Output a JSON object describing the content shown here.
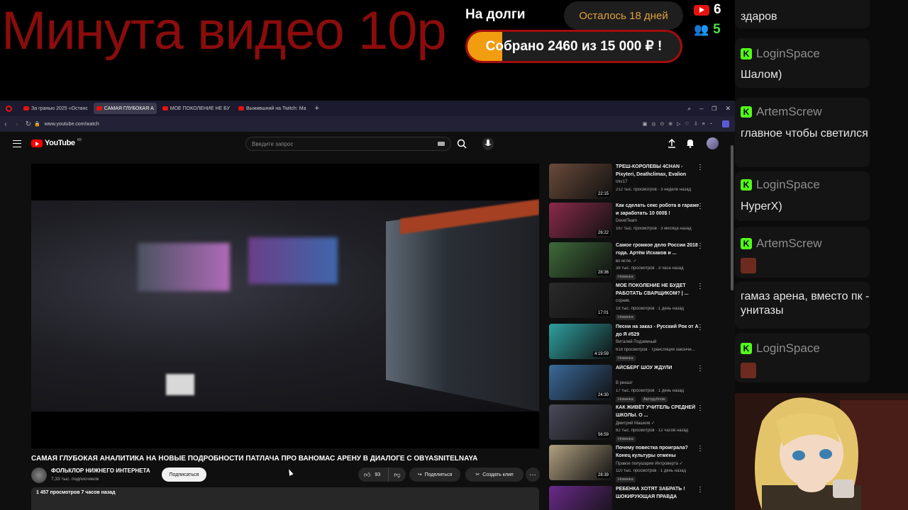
{
  "overlay": {
    "banner": "Минута видео 10р",
    "debt_title": "На долги",
    "days_left": "Осталось 18 дней",
    "collected_label": "Собрано 2460  из 15 000 ₽ !",
    "progress_fraction": 0.164,
    "viewers_youtube": "6",
    "viewers_twitch": "5",
    "colors": {
      "banner": "#8a0c0c",
      "progress": "#f29c0f",
      "progress_border": "#a30d0d",
      "days": "#e1a237",
      "kick": "#53fc18"
    }
  },
  "chat": {
    "messages": [
      {
        "user": "",
        "text": "здаров"
      },
      {
        "user": "LoginSpace",
        "text": "Шалом)"
      },
      {
        "user": "ArtemScrew",
        "text": "главное чтобы светился"
      },
      {
        "user": "LoginSpace",
        "text": "HyperX)"
      },
      {
        "user": "ArtemScrew",
        "text": ""
      },
      {
        "user": "",
        "text": "гамаз арена, вместо пк - унитазы"
      },
      {
        "user": "LoginSpace",
        "text": ""
      }
    ]
  },
  "browser": {
    "tabs": [
      {
        "label": "За гранью 2025 «Останс"
      },
      {
        "label": "САМАЯ ГЛУБОКАЯ А"
      },
      {
        "label": "МОЕ ПОКОЛЕНИЕ НЕ БУ"
      },
      {
        "label": "Выжившний на Twitch: Ма"
      }
    ],
    "url": "www.youtube.com/watch"
  },
  "youtube": {
    "logo": "YouTube",
    "region": "KR",
    "search_placeholder": "Введите запрос",
    "video_title": "САМАЯ ГЛУБОКАЯ АНАЛИТИКА НА НОВЫЕ ПОДРОБНОСТИ ПАТЛАЧА ПРО ВАНОМАС АРЕНУ В ДИАЛОГЕ С OBYASNITELNAYA",
    "channel_name": "ФОЛЬКЛОР НИЖНЕГО ИНТЕРНЕТА",
    "channel_subs": "7,33 тыс. подписчиков",
    "subscribe": "Подписаться",
    "likes": "93",
    "share": "Поделиться",
    "clip": "Создать клип",
    "more": "···",
    "views_line": "1 457 просмотров  7 часов назад",
    "suggestions": [
      {
        "title": "ТРЕШ-КОРОЛЕВЫ 4CHAN - Pixyteri, Deathclimax, Evalion",
        "channel": "trkv17",
        "meta": "212 тыс. просмотров · 3 недели назад",
        "duration": "22:15",
        "badge": "",
        "badge2": "",
        "thumb": "#6a4a3a"
      },
      {
        "title": "Как сделать секс робота в гараже и заработать 10 000$ !",
        "channel": "DevelTeam",
        "meta": "167 тыс. просмотров · 3 месяца назад",
        "duration": "26:22",
        "badge": "",
        "badge2": "",
        "thumb": "#8a2b4a"
      },
      {
        "title": "Самое громкое дело России 2018 года. Артём Исхаков и ...",
        "channel": "во мгле. ✓",
        "meta": "38 тыс. просмотров · 3 часа назад",
        "duration": "28:36",
        "badge": "Новинка",
        "badge2": "",
        "thumb": "#3f6a3a"
      },
      {
        "title": "МОЕ ПОКОЛЕНИЕ НЕ БУДЕТ РАБОТАТЬ СВАРЩИКОМ? | ...",
        "channel": "сорняк.",
        "meta": "18 тыс. просмотров · 1 день назад",
        "duration": "17:01",
        "badge": "Новинка",
        "badge2": "",
        "thumb": "#2a2a2a"
      },
      {
        "title": "Песни на заказ - Русский Рок от А до Я #529",
        "channel": "Виталий Подземный",
        "meta": "618 просмотров · Трансляция закончи...",
        "duration": "4:19:59",
        "badge": "Новинка",
        "badge2": "",
        "thumb": "#2fa0a0"
      },
      {
        "title": "АЙСБЕРГ ШОУ ЖДУЛИ",
        "channel": "В рекаэт",
        "meta": "17 тыс. просмотров · 1 день назад",
        "duration": "24:30",
        "badge": "Новинка",
        "badge2": "Автодубляж",
        "thumb": "#3a6a9a"
      },
      {
        "title": "КАК ЖИВЁТ УЧИТЕЛЬ СРЕДНЕЙ ШКОЛЫ. О ...",
        "channel": "Дмитрий Машков ✓",
        "meta": "62 тыс. просмотров · 12 часов назад",
        "duration": "56:59",
        "badge": "Новинка",
        "badge2": "",
        "thumb": "#4a4a5a"
      },
      {
        "title": "Почему повестка проиграла? Конец культуры отмены",
        "channel": "Правое полушарие Интроверта ✓",
        "meta": "110 тыс. просмотров · 1 день назад",
        "duration": "28:39",
        "badge": "Новинка",
        "badge2": "",
        "thumb": "#b0a080"
      },
      {
        "title": "РЕБЕНКА ХОТЯТ ЗАБРАТЬ ! ШОКИРУЮЩАЯ ПРАВДА",
        "channel": "",
        "meta": "",
        "duration": "",
        "badge": "",
        "badge2": "",
        "thumb": "#6a2a8a"
      }
    ]
  }
}
